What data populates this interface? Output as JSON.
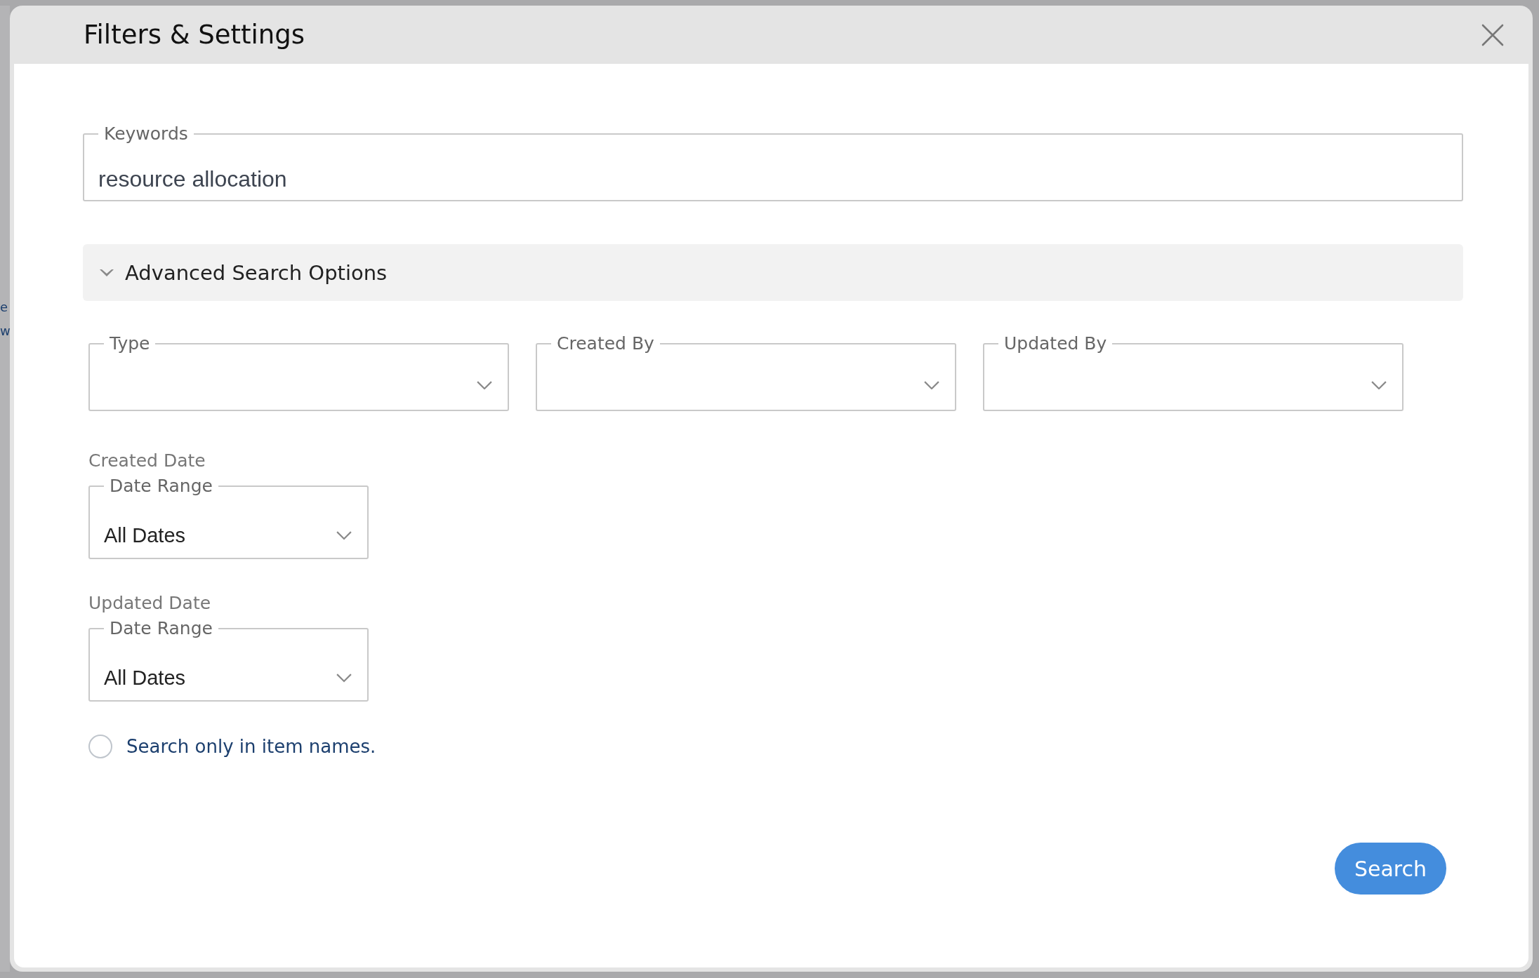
{
  "background_fragments": [
    "e",
    "w"
  ],
  "dialog": {
    "title": "Filters & Settings"
  },
  "keywords": {
    "label": "Keywords",
    "value": "resource allocation"
  },
  "advanced": {
    "label": "Advanced Search Options",
    "expanded": true
  },
  "dropdowns": [
    {
      "label": "Type"
    },
    {
      "label": "Created By"
    },
    {
      "label": "Updated By"
    }
  ],
  "date_filters": [
    {
      "heading": "Created Date",
      "label": "Date Range",
      "value": "All Dates"
    },
    {
      "heading": "Updated Date",
      "label": "Date Range",
      "value": "All Dates"
    }
  ],
  "name_only": {
    "label": "Search only in item names.",
    "checked": false
  },
  "search_button": "Search"
}
